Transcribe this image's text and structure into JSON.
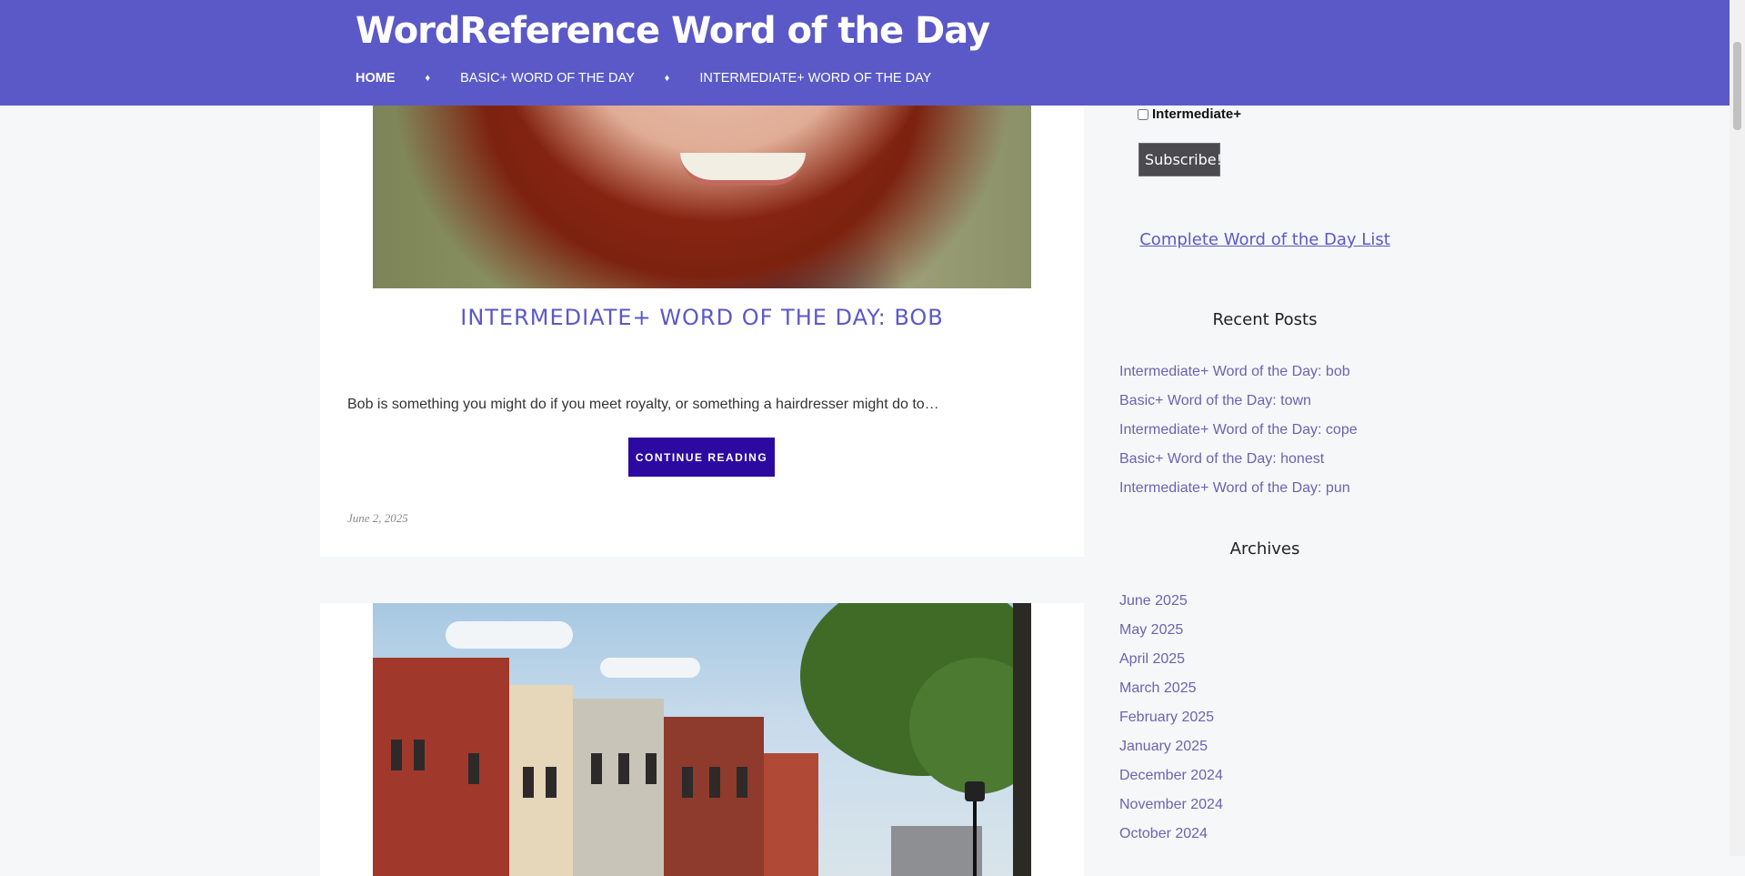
{
  "header": {
    "site_title": "WordReference Word of the Day",
    "nav": [
      {
        "label": "HOME"
      },
      {
        "label": "BASIC+ WORD OF THE DAY"
      },
      {
        "label": "INTERMEDIATE+ WORD OF THE DAY"
      }
    ],
    "nav_separator": "♦"
  },
  "posts": [
    {
      "title": "INTERMEDIATE+ WORD OF THE DAY: BOB",
      "excerpt": "Bob is something you might do if you meet royalty, or something a hairdresser might do to…",
      "continue_label": "CONTINUE READING",
      "date": "June 2, 2025"
    }
  ],
  "sidebar": {
    "checkbox_label": "Intermediate+",
    "subscribe_label": "Subscribe!",
    "complete_list_label": "Complete Word of the Day List",
    "recent_posts_title": "Recent Posts",
    "recent_posts": [
      "Intermediate+ Word of the Day: bob",
      "Basic+ Word of the Day: town",
      "Intermediate+ Word of the Day: cope",
      "Basic+ Word of the Day: honest",
      "Intermediate+ Word of the Day: pun"
    ],
    "archives_title": "Archives",
    "archives": [
      "June 2025",
      "May 2025",
      "April 2025",
      "March 2025",
      "February 2025",
      "January 2025",
      "December 2024",
      "November 2024",
      "October 2024"
    ]
  },
  "colors": {
    "header_bg": "#5b59c7",
    "accent": "#5b59c7",
    "button_bg": "#2c0aa1",
    "link": "#6b63b3"
  }
}
